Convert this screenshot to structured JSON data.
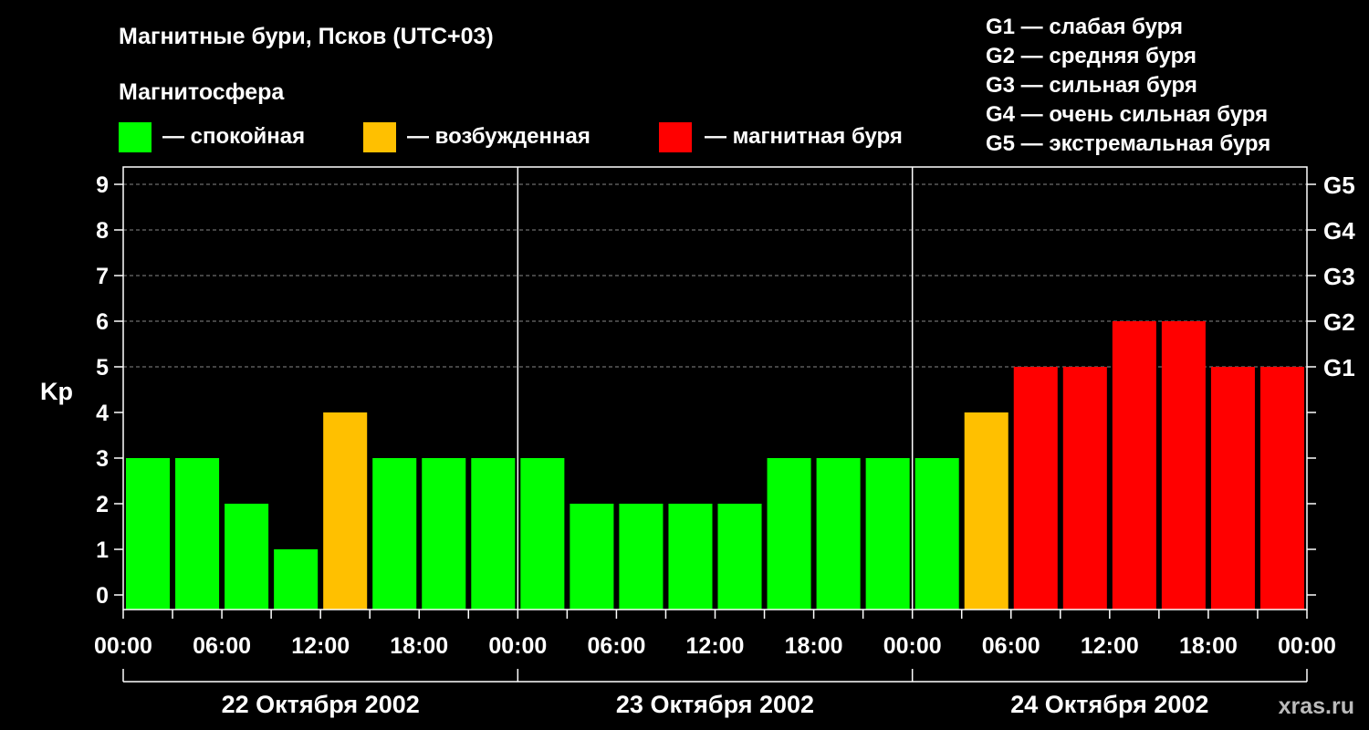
{
  "title": "Магнитные бури, Псков (UTC+03)",
  "legend": {
    "heading": "Магнитосфера",
    "items": [
      {
        "label": "— спокойная",
        "color": "#00ff00"
      },
      {
        "label": "— возбужденная",
        "color": "#ffc000"
      },
      {
        "label": "— магнитная буря",
        "color": "#ff0000"
      }
    ]
  },
  "g_scale": [
    "G1 — слабая буря",
    "G2 — средняя буря",
    "G3 — сильная буря",
    "G4 — очень сильная буря",
    "G5 — экстремальная буря"
  ],
  "watermark": "xras.ru",
  "chart_data": {
    "type": "bar",
    "ylabel": "Kp",
    "ylim": [
      0,
      9
    ],
    "yticks": [
      "0",
      "1",
      "2",
      "3",
      "4",
      "5",
      "6",
      "7",
      "8",
      "9"
    ],
    "right_ticks": [
      {
        "value": 5,
        "label": "G1"
      },
      {
        "value": 6,
        "label": "G2"
      },
      {
        "value": 7,
        "label": "G3"
      },
      {
        "value": 8,
        "label": "G4"
      },
      {
        "value": 9,
        "label": "G5"
      }
    ],
    "xtick_labels": [
      "00:00",
      "06:00",
      "12:00",
      "18:00",
      "00:00",
      "06:00",
      "12:00",
      "18:00",
      "00:00",
      "06:00",
      "12:00",
      "18:00",
      "00:00"
    ],
    "days": [
      "22 Октября 2002",
      "23 Октября 2002",
      "24 Октября 2002"
    ],
    "grid": "horizontal dashed at 5–9",
    "values": [
      3,
      3,
      2,
      1,
      4,
      3,
      3,
      3,
      3,
      2,
      2,
      2,
      2,
      3,
      3,
      3,
      3,
      4,
      5,
      5,
      6,
      6,
      5,
      5
    ],
    "colors": {
      "quiet": "#00ff00",
      "unsettled": "#ffc000",
      "storm": "#ff0000"
    }
  }
}
